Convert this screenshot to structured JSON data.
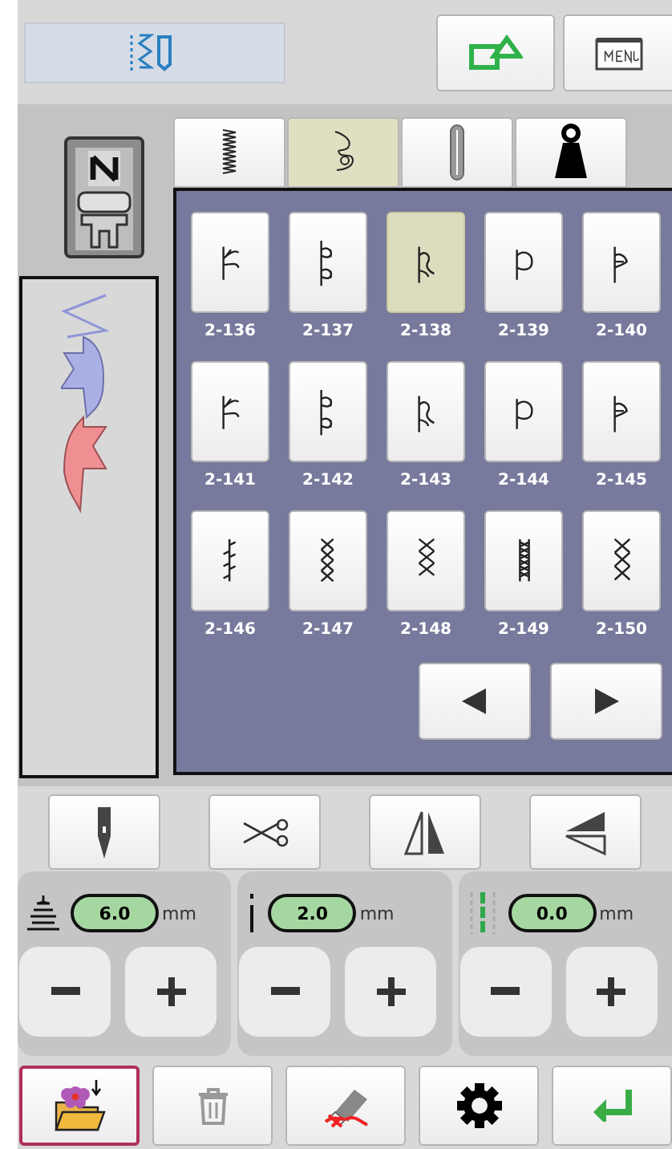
{
  "tabs": [
    {
      "kind": "zigzag",
      "selected": false
    },
    {
      "kind": "decorative",
      "selected": true
    },
    {
      "kind": "buttonhole",
      "selected": false
    },
    {
      "kind": "weight",
      "selected": false
    }
  ],
  "stitches": [
    {
      "label": "2-136",
      "selected": false
    },
    {
      "label": "2-137",
      "selected": false
    },
    {
      "label": "2-138",
      "selected": true
    },
    {
      "label": "2-139",
      "selected": false
    },
    {
      "label": "2-140",
      "selected": false
    },
    {
      "label": "2-141",
      "selected": false
    },
    {
      "label": "2-142",
      "selected": false
    },
    {
      "label": "2-143",
      "selected": false
    },
    {
      "label": "2-144",
      "selected": false
    },
    {
      "label": "2-145",
      "selected": false
    },
    {
      "label": "2-146",
      "selected": false
    },
    {
      "label": "2-147",
      "selected": false
    },
    {
      "label": "2-148",
      "selected": false
    },
    {
      "label": "2-149",
      "selected": false
    },
    {
      "label": "2-150",
      "selected": false
    }
  ],
  "parameters": [
    {
      "kind": "tension",
      "value": "6.0",
      "unit": "mm"
    },
    {
      "kind": "length",
      "value": "2.0",
      "unit": "mm"
    },
    {
      "kind": "position",
      "value": "0.0",
      "unit": "mm"
    }
  ],
  "toolbar": [
    {
      "kind": "memory",
      "selected": true
    },
    {
      "kind": "delete",
      "selected": false
    },
    {
      "kind": "clear",
      "selected": false
    },
    {
      "kind": "settings",
      "selected": false
    },
    {
      "kind": "enter",
      "selected": false
    }
  ]
}
